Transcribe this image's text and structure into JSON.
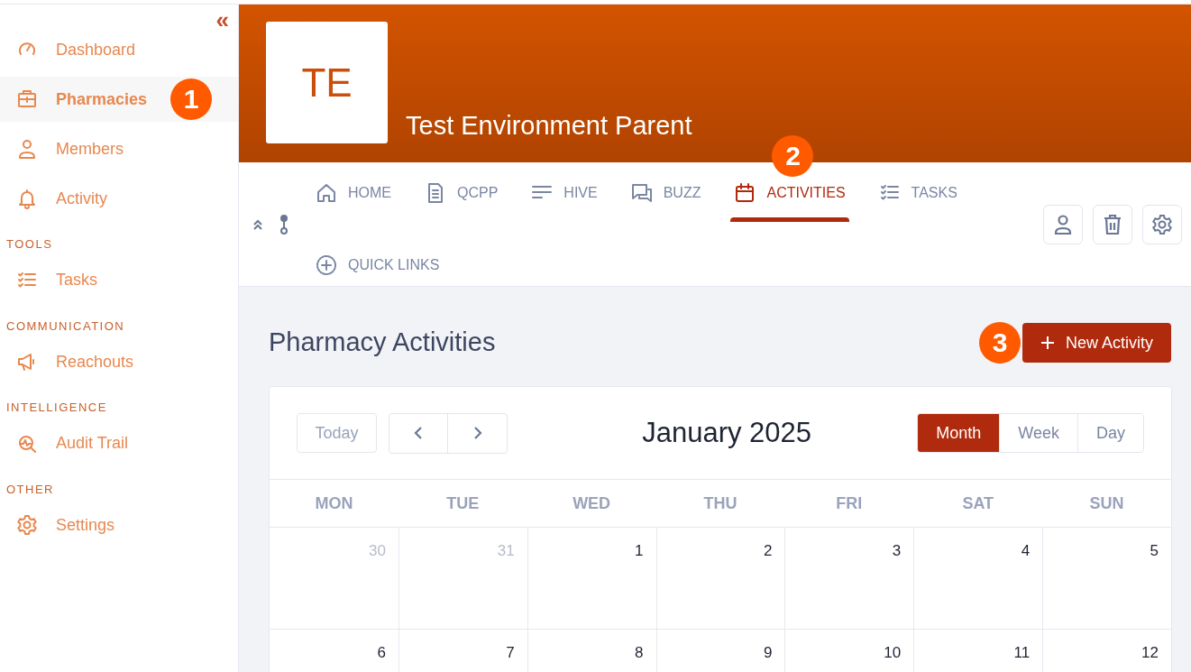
{
  "sidebar": {
    "collapse_glyph": "«",
    "sections": [
      {
        "items": [
          {
            "label": "Dashboard",
            "selected": false
          },
          {
            "label": "Pharmacies",
            "selected": true,
            "callout": "1"
          },
          {
            "label": "Members",
            "selected": false
          },
          {
            "label": "Activity",
            "selected": false
          }
        ]
      },
      {
        "heading": "TOOLS",
        "items": [
          {
            "label": "Tasks",
            "selected": false
          }
        ]
      },
      {
        "heading": "COMMUNICATION",
        "items": [
          {
            "label": "Reachouts",
            "selected": false
          }
        ]
      },
      {
        "heading": "INTELLIGENCE",
        "items": [
          {
            "label": "Audit Trail",
            "selected": false
          }
        ]
      },
      {
        "heading": "OTHER",
        "items": [
          {
            "label": "Settings",
            "selected": false
          }
        ]
      }
    ]
  },
  "header": {
    "logo": "TE",
    "title": "Test Environment Parent"
  },
  "tabs": [
    {
      "label": "HOME",
      "selected": false
    },
    {
      "label": "QCPP",
      "selected": false
    },
    {
      "label": "HIVE",
      "selected": false
    },
    {
      "label": "BUZZ",
      "selected": false
    },
    {
      "label": "ACTIVITIES",
      "selected": true,
      "callout": "2"
    },
    {
      "label": "TASKS",
      "selected": false
    },
    {
      "label": "QUICK LINKS",
      "selected": false
    }
  ],
  "page": {
    "title": "Pharmacy Activities",
    "new_button": {
      "label": "New Activity",
      "callout": "3"
    }
  },
  "calendar": {
    "today": "Today",
    "title": "January 2025",
    "views": [
      {
        "label": "Month",
        "selected": true
      },
      {
        "label": "Week",
        "selected": false
      },
      {
        "label": "Day",
        "selected": false
      }
    ],
    "weekdays": [
      "MON",
      "TUE",
      "WED",
      "THU",
      "FRI",
      "SAT",
      "SUN"
    ],
    "weeks": [
      [
        {
          "day": "30",
          "outside": true
        },
        {
          "day": "31",
          "outside": true
        },
        {
          "day": "1",
          "outside": false
        },
        {
          "day": "2",
          "outside": false
        },
        {
          "day": "3",
          "outside": false
        },
        {
          "day": "4",
          "outside": false
        },
        {
          "day": "5",
          "outside": false
        }
      ],
      [
        {
          "day": "6",
          "outside": false
        },
        {
          "day": "7",
          "outside": false
        },
        {
          "day": "8",
          "outside": false
        },
        {
          "day": "9",
          "outside": false
        },
        {
          "day": "10",
          "outside": false
        },
        {
          "day": "11",
          "outside": false
        },
        {
          "day": "12",
          "outside": false
        }
      ]
    ]
  }
}
